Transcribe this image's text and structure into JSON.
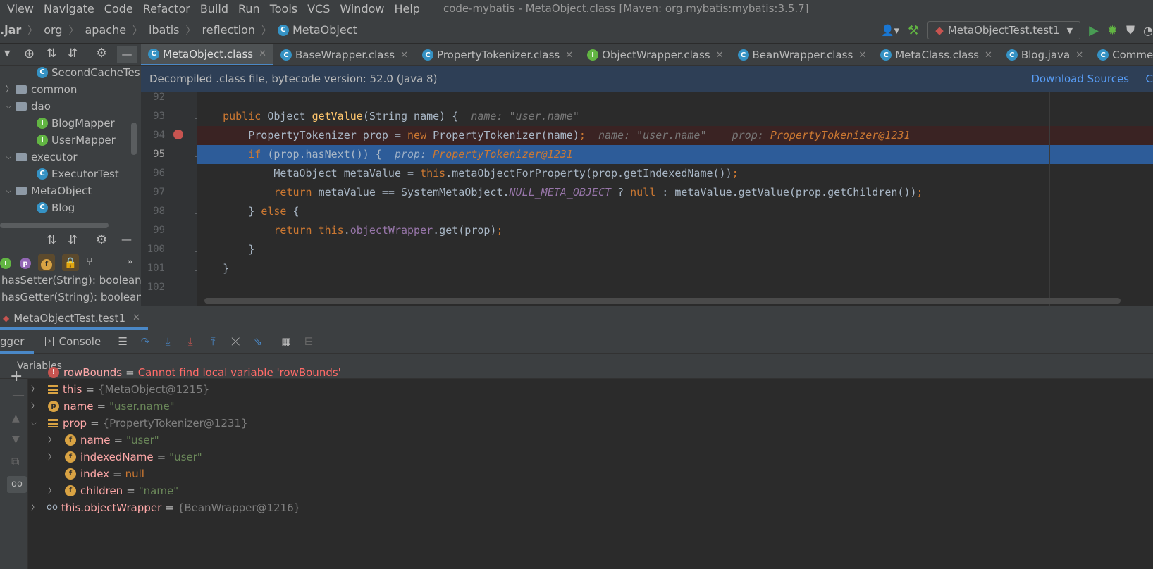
{
  "menubar": {
    "items": [
      "View",
      "Navigate",
      "Code",
      "Refactor",
      "Build",
      "Run",
      "Tools",
      "VCS",
      "Window",
      "Help"
    ],
    "window_title": "code-mybatis - MetaObject.class [Maven: org.mybatis:mybatis:3.5.7]"
  },
  "breadcrumb": {
    "items": [
      ".jar",
      "org",
      "apache",
      "ibatis",
      "reflection",
      "MetaObject"
    ]
  },
  "run_config": {
    "label": "MetaObjectTest.test1"
  },
  "project_tree": {
    "items": [
      {
        "label": "SecondCacheTes",
        "type": "class",
        "indent": 2,
        "arrow": ""
      },
      {
        "label": "common",
        "type": "folder",
        "indent": 1,
        "arrow": "›"
      },
      {
        "label": "dao",
        "type": "folder",
        "indent": 1,
        "arrow": "⌄"
      },
      {
        "label": "BlogMapper",
        "type": "interface",
        "indent": 2,
        "arrow": ""
      },
      {
        "label": "UserMapper",
        "type": "interface",
        "indent": 2,
        "arrow": ""
      },
      {
        "label": "executor",
        "type": "folder",
        "indent": 1,
        "arrow": "⌄"
      },
      {
        "label": "ExecutorTest",
        "type": "class",
        "indent": 2,
        "arrow": ""
      },
      {
        "label": "MetaObject",
        "type": "folder",
        "indent": 1,
        "arrow": "⌄"
      },
      {
        "label": "Blog",
        "type": "class",
        "indent": 2,
        "arrow": ""
      }
    ]
  },
  "structure": {
    "items": [
      "hasSetter(String): boolean",
      "hasGetter(String): boolean"
    ]
  },
  "editor_tabs": [
    {
      "label": "MetaObject.class",
      "active": true
    },
    {
      "label": "BaseWrapper.class",
      "active": false
    },
    {
      "label": "PropertyTokenizer.class",
      "active": false
    },
    {
      "label": "ObjectWrapper.class",
      "active": false
    },
    {
      "label": "BeanWrapper.class",
      "active": false
    },
    {
      "label": "MetaClass.class",
      "active": false
    },
    {
      "label": "Blog.java",
      "active": false
    },
    {
      "label": "Commen",
      "active": false
    }
  ],
  "banner": {
    "text": "Decompiled .class file, bytecode version: 52.0 (Java 8)",
    "link": "Download Sources",
    "link2": "C"
  },
  "code": {
    "line_numbers": [
      "92",
      "93",
      "94",
      "95",
      "96",
      "97",
      "98",
      "99",
      "100",
      "101",
      "102"
    ],
    "l93": {
      "kw": "public",
      "type": " Object ",
      "fn": "getValue",
      "rest": "(String name) {",
      "hint": "name: \"user.name\""
    },
    "l94": {
      "a": "PropertyTokenizer prop = ",
      "kw": "new",
      "b": " PropertyTokenizer(name)",
      "semi": ";",
      "hint1": "name: \"user.name\"",
      "hint2": "prop: ",
      "hval": "PropertyTokenizer@1231"
    },
    "l95": {
      "kw": "if",
      "b": " (prop.hasNext()) {",
      "hint": "prop: ",
      "hval": "PropertyTokenizer@1231"
    },
    "l96": {
      "a": "MetaObject metaValue = ",
      "kw": "this",
      "b": ".metaObjectForProperty(prop.getIndexedName())",
      "semi": ";"
    },
    "l97": {
      "kw": "return",
      "a": " metaValue == SystemMetaObject.",
      "st": "NULL_META_OBJECT",
      "b": " ? ",
      "kw2": "null",
      "c": " : metaValue.getValue(prop.getChildren())",
      "semi": ";"
    },
    "l98": {
      "a": "} ",
      "kw": "else",
      "b": " {"
    },
    "l99": {
      "kw": "return",
      "sp": " ",
      "kw2": "this",
      "dot": ".",
      "fld": "objectWrapper",
      "b": ".get(prop)",
      "semi": ";"
    },
    "l100": {
      "a": "}"
    },
    "l101": {
      "a": "}"
    }
  },
  "debug": {
    "title": "MetaObjectTest.test1",
    "tab_debugger": "gger",
    "tab_console": "Console",
    "vars_header": "Variables",
    "variables": [
      {
        "name": "rowBounds",
        "value": "Cannot find local variable 'rowBounds'",
        "kind": "error",
        "icon": "error-icon",
        "depth": 0,
        "arrow": ""
      },
      {
        "name": "this",
        "value": "{MetaObject@1215}",
        "kind": "obj",
        "icon": "field-list-icon",
        "depth": 0,
        "arrow": "›"
      },
      {
        "name": "name",
        "value": "\"user.name\"",
        "kind": "str",
        "icon": "param-icon",
        "depth": 0,
        "arrow": "›"
      },
      {
        "name": "prop",
        "value": "{PropertyTokenizer@1231}",
        "kind": "obj",
        "icon": "field-list-icon",
        "depth": 0,
        "arrow": "⌄"
      },
      {
        "name": "name",
        "value": "\"user\"",
        "kind": "str",
        "icon": "field-icon",
        "depth": 1,
        "arrow": "›"
      },
      {
        "name": "indexedName",
        "value": "\"user\"",
        "kind": "str",
        "icon": "field-icon",
        "depth": 1,
        "arrow": "›"
      },
      {
        "name": "index",
        "value": "null",
        "kind": "null",
        "icon": "field-icon",
        "depth": 1,
        "arrow": ""
      },
      {
        "name": "children",
        "value": "\"name\"",
        "kind": "str",
        "icon": "field-icon",
        "depth": 1,
        "arrow": "›"
      },
      {
        "name": "this.objectWrapper",
        "value": "{BeanWrapper@1216}",
        "kind": "obj",
        "icon": "watch-icon",
        "depth": 0,
        "arrow": "›"
      }
    ]
  },
  "colors": {
    "accent": "#4a88c7",
    "exec_line": "#2d5c99",
    "breakpoint_line": "#3a2323",
    "breakpoint": "#c75450"
  }
}
